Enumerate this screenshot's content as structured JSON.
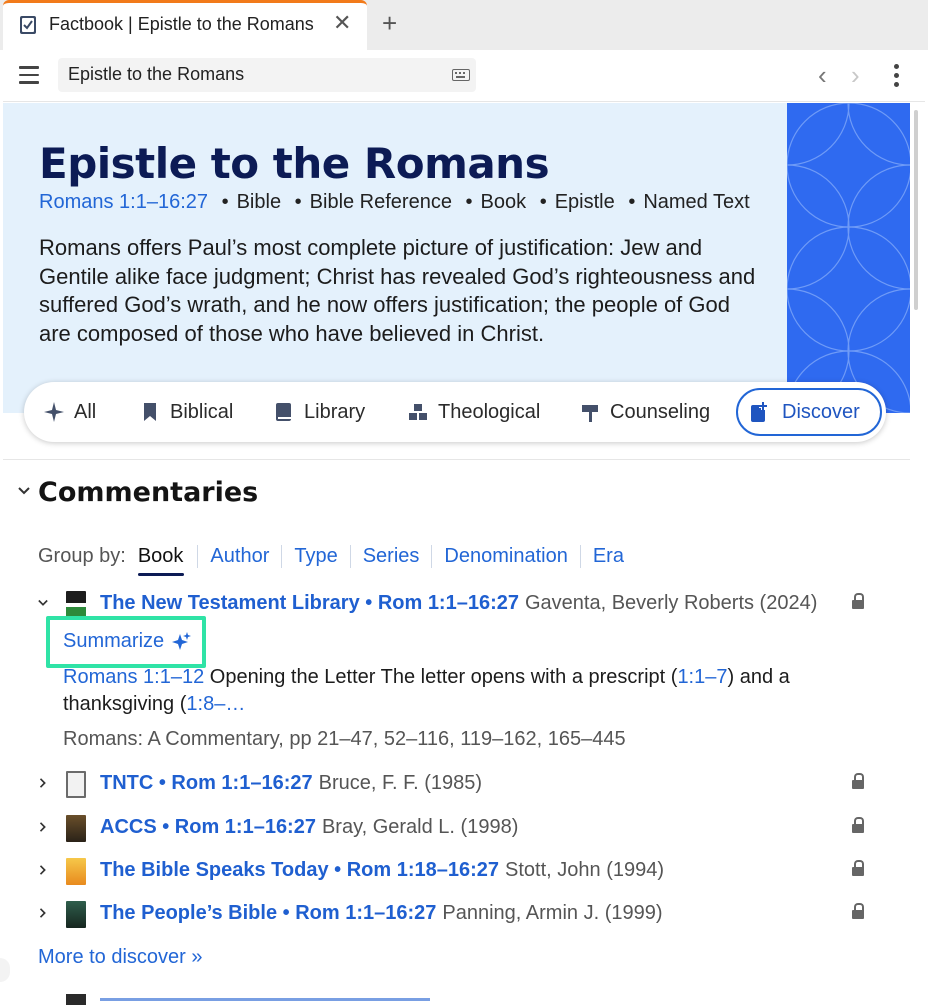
{
  "tab": {
    "title": "Factbook | Epistle to the Romans",
    "close_icon": "close-icon",
    "new_tab_icon": "plus-icon"
  },
  "address": {
    "value": "Epistle to the Romans"
  },
  "hero": {
    "title": "Epistle to the Romans",
    "reference": "Romans 1:1–16:27",
    "tags": [
      "Bible",
      "Bible Reference",
      "Book",
      "Epistle",
      "Named Text"
    ],
    "description": "Romans offers Paul’s most complete picture of justification: Jew and Gentile alike face judgment; Christ has revealed God’s righteousness and suffered God’s wrath, and he now offers justification; the people of God are composed of those who have believed in Christ."
  },
  "filters": [
    {
      "label": "All",
      "icon": "sparkle-icon"
    },
    {
      "label": "Biblical",
      "icon": "bookmark-icon"
    },
    {
      "label": "Library",
      "icon": "book-icon"
    },
    {
      "label": "Theological",
      "icon": "blocks-icon"
    },
    {
      "label": "Counseling",
      "icon": "signpost-icon"
    },
    {
      "label": "Discover",
      "icon": "add-bookmark-icon",
      "active": true
    }
  ],
  "commentaries": {
    "title": "Commentaries",
    "group_by_label": "Group by:",
    "group_by_options": [
      "Book",
      "Author",
      "Type",
      "Series",
      "Denomination",
      "Era"
    ],
    "group_by_selected": "Book",
    "items": [
      {
        "title": "The New Testament Library • Rom 1:1–16:27",
        "meta": "Gaventa, Beverly Roberts (2024)",
        "expanded": true
      },
      {
        "title": "TNTC • Rom 1:1–16:27",
        "meta": "Bruce, F. F. (1985)"
      },
      {
        "title": "ACCS • Rom 1:1–16:27",
        "meta": "Bray, Gerald L. (1998)"
      },
      {
        "title": "The Bible Speaks Today • Rom 1:18–16:27",
        "meta": "Stott, John (1994)"
      },
      {
        "title": "The People’s Bible • Rom 1:1–16:27",
        "meta": "Panning, Armin J. (1999)"
      }
    ],
    "summarize_label": "Summarize",
    "excerpt": {
      "ref": "Romans 1:1–12",
      "text1": " Opening the Letter The letter opens with a prescript (",
      "ref2": "1:1–7",
      "text2": ") and a thanksgiving (",
      "ref3": "1:8–…",
      "source": "Romans: A Commentary, pp 21–47, 52–116, 119–162, 165–445"
    },
    "more_label": "More to discover »"
  },
  "colors": {
    "accent": "#2266d6",
    "hero_bg": "#e4f1fc",
    "hero_art": "#2f6af0",
    "title_navy": "#0c1b55",
    "highlight": "#2fe3a6",
    "tab_accent": "#f27a1a"
  }
}
